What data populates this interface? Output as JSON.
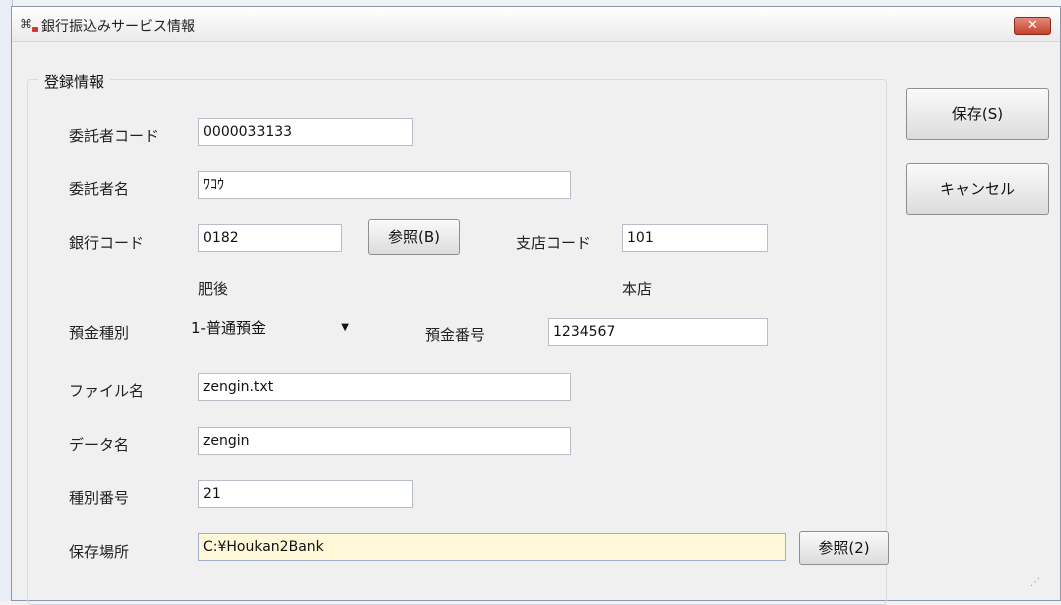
{
  "window": {
    "title": "銀行振込みサービス情報",
    "icon": "app-icon",
    "close_label": "✕"
  },
  "group": {
    "title": "登録情報"
  },
  "fields": {
    "consignor_code": {
      "label": "委託者コード",
      "value": "0000033133"
    },
    "consignor_name": {
      "label": "委託者名",
      "value": "ﾜｺｳ"
    },
    "bank_code": {
      "label": "銀行コード",
      "value": "0182",
      "name_display": "肥後"
    },
    "bank_ref_button": "参照(B)",
    "branch_code": {
      "label": "支店コード",
      "value": "101",
      "name_display": "本店"
    },
    "deposit_type": {
      "label": "預金種別",
      "value": "1-普通預金"
    },
    "account_number": {
      "label": "預金番号",
      "value": "1234567"
    },
    "file_name": {
      "label": "ファイル名",
      "value": "zengin.txt"
    },
    "data_name": {
      "label": "データ名",
      "value": "zengin"
    },
    "type_number": {
      "label": "種別番号",
      "value": "21"
    },
    "save_location": {
      "label": "保存場所",
      "value": "C:¥Houkan2Bank"
    },
    "save_ref_button": "参照(2)"
  },
  "actions": {
    "save": "保存(S)",
    "cancel": "キャンセル"
  }
}
